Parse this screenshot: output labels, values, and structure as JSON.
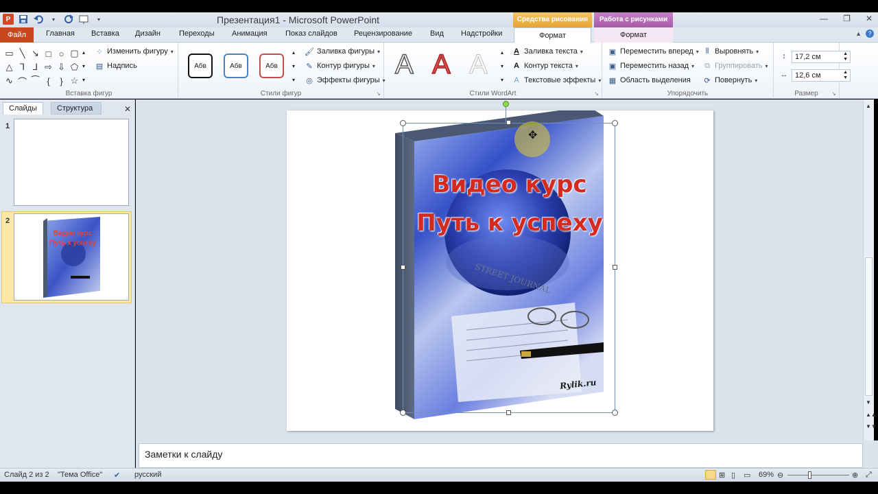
{
  "titlebar": {
    "title": "Презентация1 - Microsoft PowerPoint",
    "ctx_drawing_tools": "Средства рисования",
    "ctx_picture_tools": "Работа с рисунками"
  },
  "tabs": {
    "file": "Файл",
    "items": [
      "Главная",
      "Вставка",
      "Дизайн",
      "Переходы",
      "Анимация",
      "Показ слайдов",
      "Рецензирование",
      "Вид",
      "Надстройки"
    ],
    "format_drawing": "Формат",
    "format_picture": "Формат"
  },
  "ribbon": {
    "insert_shapes": {
      "change_shape": "Изменить фигуру",
      "textbox": "Надпись",
      "label": "Вставка фигур"
    },
    "shape_styles": {
      "preset": "Абв",
      "fill": "Заливка фигуры",
      "outline": "Контур фигуры",
      "effects": "Эффекты фигуры",
      "label": "Стили фигур"
    },
    "wordart": {
      "glyph": "A",
      "text_fill": "Заливка текста",
      "text_outline": "Контур текста",
      "text_effects": "Текстовые эффекты",
      "label": "Стили WordArt"
    },
    "arrange": {
      "bring_forward": "Переместить вперед",
      "send_backward": "Переместить назад",
      "selection_pane": "Область выделения",
      "align": "Выровнять",
      "group": "Группировать",
      "rotate": "Повернуть",
      "label": "Упорядочить"
    },
    "size": {
      "height": "17,2 см",
      "width": "12,6 см",
      "label": "Размер"
    }
  },
  "left_pane": {
    "tab_slides": "Слайды",
    "tab_outline": "Структура",
    "slides": [
      {
        "number": "1"
      },
      {
        "number": "2",
        "line1": "Видео курс",
        "line2": "Путь к успеху"
      }
    ]
  },
  "slide": {
    "title_line1": "Видео курс",
    "title_line2": "Путь к успеху",
    "signature": "Rylik.ru",
    "newspaper_heading": "STREET JOURNAL"
  },
  "notes": {
    "placeholder": "Заметки к слайду"
  },
  "status": {
    "slide_counter": "Слайд 2 из 2",
    "theme": "\"Тема Office\"",
    "language": "русский",
    "zoom": "69%"
  },
  "colors": {
    "file_tab": "#c9471f",
    "ctx_drawing": "#e8a431",
    "ctx_picture": "#a55ba5",
    "title_red": "#d42a1f"
  }
}
